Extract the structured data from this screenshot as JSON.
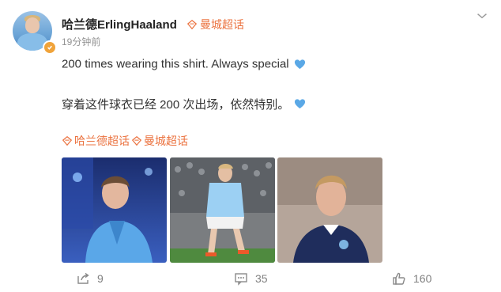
{
  "post": {
    "author": "哈兰德ErlingHaaland",
    "supertopic_label": "曼城超话",
    "timestamp": "19分钟前",
    "text_en": "200 times wearing this shirt. Always special",
    "text_zh": "穿着这件球衣已经 200 次出场，依然特别。",
    "emoji": "blue-heart",
    "tags": [
      {
        "label": "哈兰德超话",
        "icon": "diamond-topic-icon"
      },
      {
        "label": "曼城超话",
        "icon": "diamond-topic-icon"
      }
    ]
  },
  "photos": [
    {
      "desc_icon": "photo-portrait-blue-jacket"
    },
    {
      "desc_icon": "photo-match-action"
    },
    {
      "desc_icon": "photo-portrait-navy-kit"
    }
  ],
  "actions": {
    "share_count": "9",
    "comment_count": "35",
    "like_count": "160"
  },
  "colors": {
    "accent_orange": "#eb7340",
    "heart_blue": "#5aa8e6",
    "muted_gray": "#939393"
  }
}
